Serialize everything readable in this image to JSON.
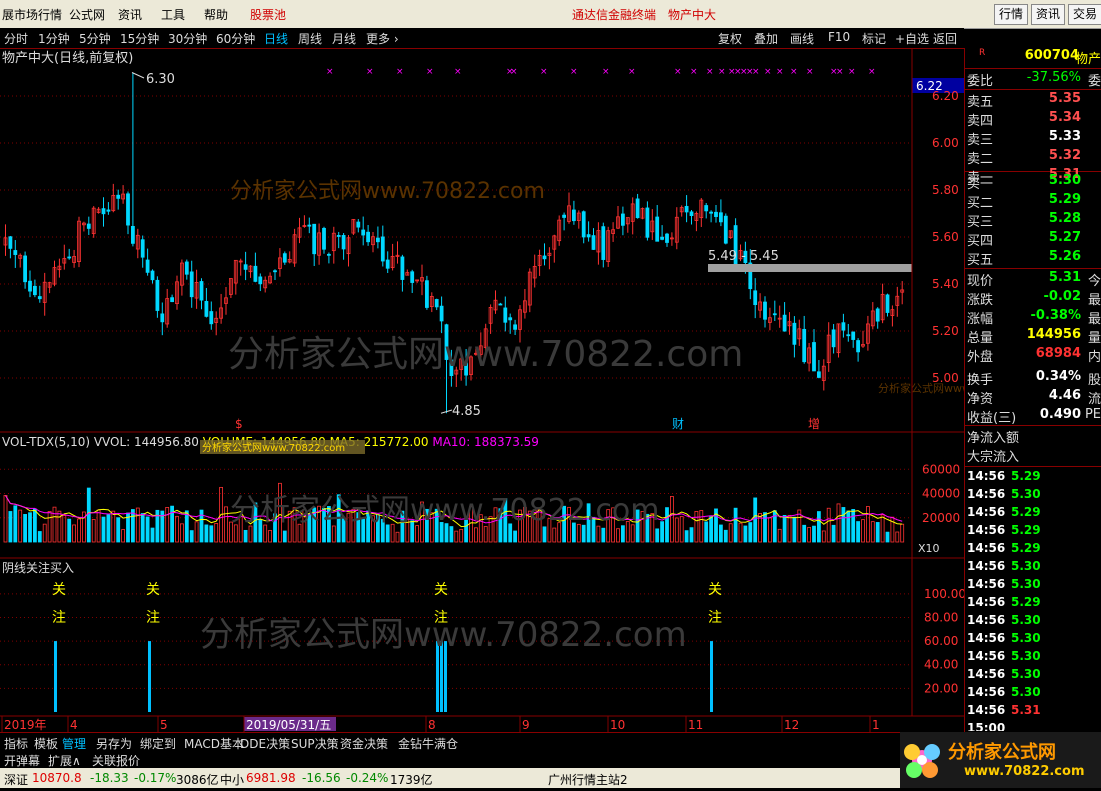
{
  "menubar": {
    "items": [
      "展市场行情",
      "公式网",
      "资讯",
      "工具",
      "帮助"
    ],
    "red_items": [
      "股票池"
    ],
    "center": [
      "通达信金融终端",
      "物产中大"
    ],
    "right_buttons": [
      "行情",
      "资讯",
      "交易"
    ]
  },
  "toolbar": {
    "periods": [
      "分时",
      "1分钟",
      "5分钟",
      "15分钟",
      "30分钟",
      "60分钟",
      "日线",
      "周线",
      "月线",
      "更多 ›"
    ],
    "active": "日线",
    "tools": [
      "复权",
      "叠加",
      "画线",
      "F10",
      "标记",
      "+自选",
      "返回"
    ]
  },
  "chart": {
    "title": "物产中大(日线,前复权)",
    "high_label": "6.30",
    "low_label": "4.85",
    "price_box": "6.22",
    "range_label": "5.49 - 5.45",
    "y_ticks": [
      "6.20",
      "6.00",
      "5.80",
      "5.60",
      "5.40",
      "5.20",
      "5.00"
    ],
    "event_marks": [
      "$",
      "财",
      "增"
    ],
    "watermark": "分析家公式网www.70822.com",
    "watermark_small": "分析家公式网www.70822.com"
  },
  "volume": {
    "label": "VOL-TDX(5,10) VVOL: 144956.80↓ VOLUME: 144956.80↓ MA5: 215772.00↓ MA10: 188373.59↑",
    "parts": {
      "a": "VOL-TDX(5,10) VVOL: 144956.80",
      "b": "VOLUME: 144956.80",
      "c": "MA5: 215772.00",
      "d": "MA10: 188373.59"
    },
    "y_ticks": [
      "60000",
      "40000",
      "20000"
    ],
    "unit": "X10"
  },
  "indicator": {
    "label": "阴线关注买入",
    "y_ticks": [
      "100.00",
      "80.00",
      "60.00",
      "40.00",
      "20.00"
    ],
    "signal_text_a": "关",
    "signal_text_b": "注"
  },
  "xaxis": {
    "labels": [
      "2019年",
      "4",
      "5",
      "2019/05/31/五",
      "8",
      "9",
      "10",
      "11",
      "12",
      "1"
    ]
  },
  "quote": {
    "code": "600704",
    "name": "物产",
    "weibi_label": "委比",
    "weibi": "-37.56%",
    "weibi_ext": "委",
    "asks": [
      {
        "label": "卖五",
        "price": "5.35"
      },
      {
        "label": "卖四",
        "price": "5.34"
      },
      {
        "label": "卖三",
        "price": "5.33"
      },
      {
        "label": "卖二",
        "price": "5.32"
      },
      {
        "label": "卖一",
        "price": "5.31"
      }
    ],
    "bids": [
      {
        "label": "买一",
        "price": "5.30"
      },
      {
        "label": "买二",
        "price": "5.29"
      },
      {
        "label": "买三",
        "price": "5.28"
      },
      {
        "label": "买四",
        "price": "5.27"
      },
      {
        "label": "买五",
        "price": "5.26"
      }
    ],
    "stats": [
      {
        "label": "现价",
        "value": "5.31",
        "ext": "今"
      },
      {
        "label": "涨跌",
        "value": "-0.02",
        "ext": "最"
      },
      {
        "label": "涨幅",
        "value": "-0.38%",
        "ext": "最"
      },
      {
        "label": "总量",
        "value": "144956",
        "ext": "量"
      },
      {
        "label": "外盘",
        "value": "68984",
        "ext": "内"
      },
      {
        "label": "换手",
        "value": "0.34%",
        "ext": "股"
      },
      {
        "label": "净资",
        "value": "4.46",
        "ext": "流"
      },
      {
        "label": "收益(三)",
        "value": "0.490",
        "ext": "PE"
      }
    ],
    "flow": [
      "净流入额",
      "大宗流入"
    ],
    "trades": [
      {
        "t": "14:56",
        "p": "5.29"
      },
      {
        "t": "14:56",
        "p": "5.30"
      },
      {
        "t": "14:56",
        "p": "5.29"
      },
      {
        "t": "14:56",
        "p": "5.29"
      },
      {
        "t": "14:56",
        "p": "5.29"
      },
      {
        "t": "14:56",
        "p": "5.30"
      },
      {
        "t": "14:56",
        "p": "5.30"
      },
      {
        "t": "14:56",
        "p": "5.29"
      },
      {
        "t": "14:56",
        "p": "5.30"
      },
      {
        "t": "14:56",
        "p": "5.30"
      },
      {
        "t": "14:56",
        "p": "5.30"
      },
      {
        "t": "14:56",
        "p": "5.30"
      },
      {
        "t": "14:56",
        "p": "5.30"
      },
      {
        "t": "14:56",
        "p": "5.31"
      }
    ],
    "last_trade": "15:00"
  },
  "bottom_tabs": [
    "指标",
    "模板",
    "管理",
    "另存为",
    "绑定到",
    "MACD基本",
    "DDE决策",
    "SUP决策",
    "资金决策",
    "金钻牛满仓"
  ],
  "bottom_tabs_sel": "管理",
  "bottom_tabs2": [
    "开弹幕",
    "扩展∧",
    "关联报价"
  ],
  "statusbar": {
    "a": "深证",
    "a_val": "10870.8",
    "a_chg": "-18.33",
    "a_pct": "-0.17%",
    "a_amt": "3086亿",
    "b": "中小",
    "b_val": "6981.98",
    "b_chg": "-16.56",
    "b_pct": "-0.24%",
    "b_amt": "1739亿",
    "c": "广州行情主站2"
  },
  "logo": {
    "text": "分析家公式网",
    "url": "www.70822.com"
  },
  "colors": {
    "up": "#ff3232",
    "down": "#00d8ff",
    "ma5": "#ffff00",
    "ma10": "#ff00ff",
    "grid": "#800000"
  }
}
